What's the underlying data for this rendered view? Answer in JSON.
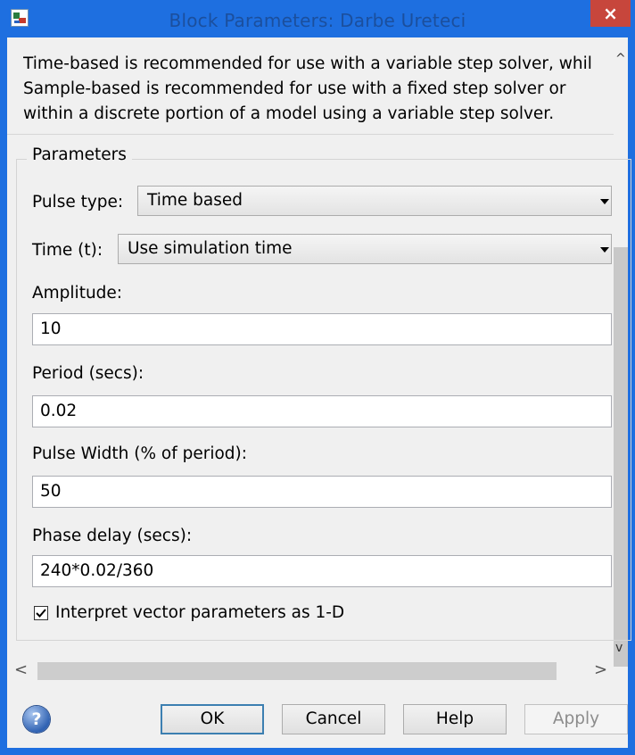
{
  "window": {
    "title": "Block Parameters: Darbe Ureteci",
    "close_label": "×"
  },
  "description": {
    "lines": [
      "Time-based is recommended for use with a variable step solver, whil",
      "Sample-based is recommended for use with a fixed step solver or",
      "within a discrete portion of a model using a variable step solver."
    ]
  },
  "parameters": {
    "group_title": "Parameters",
    "pulse_type": {
      "label": "Pulse type:",
      "value": "Time based"
    },
    "time": {
      "label": "Time (t):",
      "value": "Use simulation time"
    },
    "amplitude": {
      "label": "Amplitude:",
      "value": "10"
    },
    "period": {
      "label": "Period (secs):",
      "value": "0.02"
    },
    "pulse_width": {
      "label": "Pulse Width (% of period):",
      "value": "50"
    },
    "phase_delay": {
      "label": "Phase delay (secs):",
      "value": "240*0.02/360"
    },
    "interpret_vector": {
      "label": "Interpret vector parameters as 1-D",
      "checked": true
    }
  },
  "scrollbars": {
    "up_glyph": "^",
    "down_glyph": "v",
    "left_glyph": "<",
    "right_glyph": ">"
  },
  "buttons": {
    "help_icon_glyph": "?",
    "ok": "OK",
    "cancel": "Cancel",
    "help": "Help",
    "apply": "Apply"
  },
  "icons": {
    "app": "simulink-block-icon",
    "help": "help-question-icon",
    "close": "close-icon"
  },
  "colors": {
    "titlebar": "#1e6fe0",
    "close_button": "#c7463c",
    "dialog_bg": "#f0f0f0",
    "default_button_border": "#3c7fb1"
  }
}
